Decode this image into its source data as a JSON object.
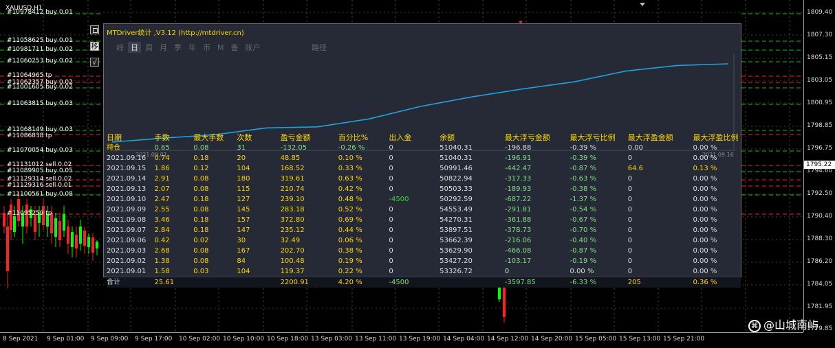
{
  "chart": {
    "symbol": "XAUUSD,H1",
    "order_labels": [
      "#10978412 buy 0.01",
      "#11058625 buy 0.01",
      "#10981711 buy 0.02",
      "#11060253 buy 0.02",
      "#11064965 tp",
      "#11062357 buy 0.02",
      "#11001605 buy 0.02",
      "#11063815 buy 0.03",
      "#11068149 buy 0.03",
      "#11086838 tp",
      "#11070054 buy 0.03",
      "#11131012 sell 0.02",
      "#11089905 buy 0.05",
      "#11129314 sell 0.02",
      "#11129316 sell 0.01",
      "#11100561 buy 0.08",
      "#11095259 tp"
    ],
    "price_ticks": [
      "1809.40",
      "1807.30",
      "1805.15",
      "1803.05",
      "1800.95",
      "1798.85",
      "1796.75",
      "1794.60",
      "1792.50",
      "1790.40",
      "1788.30",
      "1786.20",
      "1784.05",
      "1781.95",
      "1779.85"
    ],
    "current_price": "1795.22",
    "time_ticks": [
      "8 Sep 2021",
      "9 Sep 01:00",
      "9 Sep 09:00",
      "9 Sep 17:00",
      "10 Sep 02:00",
      "10 Sep 10:00",
      "10 Sep 18:00",
      "13 Sep 03:00",
      "13 Sep 11:00",
      "13 Sep 19:00",
      "14 Sep 04:00",
      "14 Sep 12:00",
      "14 Sep 20:00",
      "15 Sep 05:00",
      "15 Sep 13:00",
      "15 Sep 21:00"
    ],
    "watermark": "@山城南屿",
    "side_button_label": "移",
    "check_button_label": "√",
    "colors": {
      "bull": "#00ff00",
      "bear": "#ff2020",
      "buy_line": "#00cc00",
      "sell_line": "#ff2020",
      "tp_line": "#ff2020",
      "grid": "#808080"
    }
  },
  "panel": {
    "title": "MTDriver统计 ,V3.12 (http://mtdriver.cn)",
    "tabs": [
      "综",
      "日",
      "周",
      "月",
      "季",
      "年",
      "币",
      "M",
      "备",
      "账户"
    ],
    "active_tab": "日",
    "path_tab": "路径",
    "equity": {
      "start_label": "2021.09.01",
      "end_label": "2021.09.16",
      "line_color": "#1fa3e0"
    },
    "table": {
      "headers": [
        "日期",
        "手数",
        "最大手数",
        "次数",
        "盈亏金额",
        "百分比%",
        "出入金",
        "余额",
        "最大浮亏金额",
        "最大浮亏比例",
        "最大浮盈金额",
        "最大浮盈比例"
      ],
      "holding": [
        "持仓",
        "0.65",
        "0.08",
        "31",
        "-132.05",
        "-0.26 %",
        "0",
        "51040.31",
        "-196.88",
        "-0.39 %",
        "0.00",
        "0.00 %"
      ],
      "rows": [
        [
          "2021.09.16",
          "0.74",
          "0.18",
          "20",
          "48.85",
          "0.10 %",
          "0",
          "51040.31",
          "-196.91",
          "-0.39 %",
          "0",
          "0.00 %"
        ],
        [
          "2021.09.15",
          "1.86",
          "0.12",
          "104",
          "168.52",
          "0.33 %",
          "0",
          "50991.46",
          "-442.47",
          "-0.87 %",
          "64.6",
          "0.13 %"
        ],
        [
          "2021.09.14",
          "2.91",
          "0.08",
          "180",
          "319.61",
          "0.63 %",
          "0",
          "50822.94",
          "-317.33",
          "-0.63 %",
          "0",
          "0.00 %"
        ],
        [
          "2021.09.13",
          "2.07",
          "0.08",
          "115",
          "210.74",
          "0.42 %",
          "0",
          "50503.33",
          "-189.93",
          "-0.38 %",
          "0",
          "0.00 %"
        ],
        [
          "2021.09.10",
          "2.47",
          "0.18",
          "127",
          "239.10",
          "0.48 %",
          "-4500",
          "50292.59",
          "-687.22",
          "-1.37 %",
          "0",
          "0.00 %"
        ],
        [
          "2021.09.09",
          "2.55",
          "0.08",
          "145",
          "283.18",
          "0.52 %",
          "0",
          "54553.49",
          "-291.81",
          "-0.54 %",
          "0",
          "0.00 %"
        ],
        [
          "2021.09.08",
          "3.46",
          "0.18",
          "157",
          "372.80",
          "0.69 %",
          "0",
          "54270.31",
          "-361.88",
          "-0.67 %",
          "0",
          "0.00 %"
        ],
        [
          "2021.09.07",
          "2.84",
          "0.18",
          "147",
          "235.12",
          "0.44 %",
          "0",
          "53897.51",
          "-378.73",
          "-0.70 %",
          "0",
          "0.00 %"
        ],
        [
          "2021.09.06",
          "0.42",
          "0.02",
          "30",
          "32.49",
          "0.06 %",
          "0",
          "53662.39",
          "-216.06",
          "-0.40 %",
          "0",
          "0.00 %"
        ],
        [
          "2021.09.03",
          "2.68",
          "0.08",
          "167",
          "202.70",
          "0.38 %",
          "0",
          "53629.90",
          "-466.08",
          "-0.87 %",
          "0",
          "0.00 %"
        ],
        [
          "2021.09.02",
          "1.38",
          "0.08",
          "84",
          "100.48",
          "0.19 %",
          "0",
          "53427.20",
          "-103.17",
          "-0.19 %",
          "0",
          "0.00 %"
        ],
        [
          "2021.09.01",
          "1.58",
          "0.03",
          "104",
          "119.37",
          "0.22 %",
          "0",
          "53326.72",
          "0",
          "0.00 %",
          "0",
          "0.00 %"
        ]
      ],
      "total": [
        "合计",
        "25.61",
        "",
        "",
        "2200.91",
        "4.20 %",
        "-4500",
        "",
        "-3597.85",
        "-6.33 %",
        "205",
        "0.36 %"
      ]
    }
  }
}
